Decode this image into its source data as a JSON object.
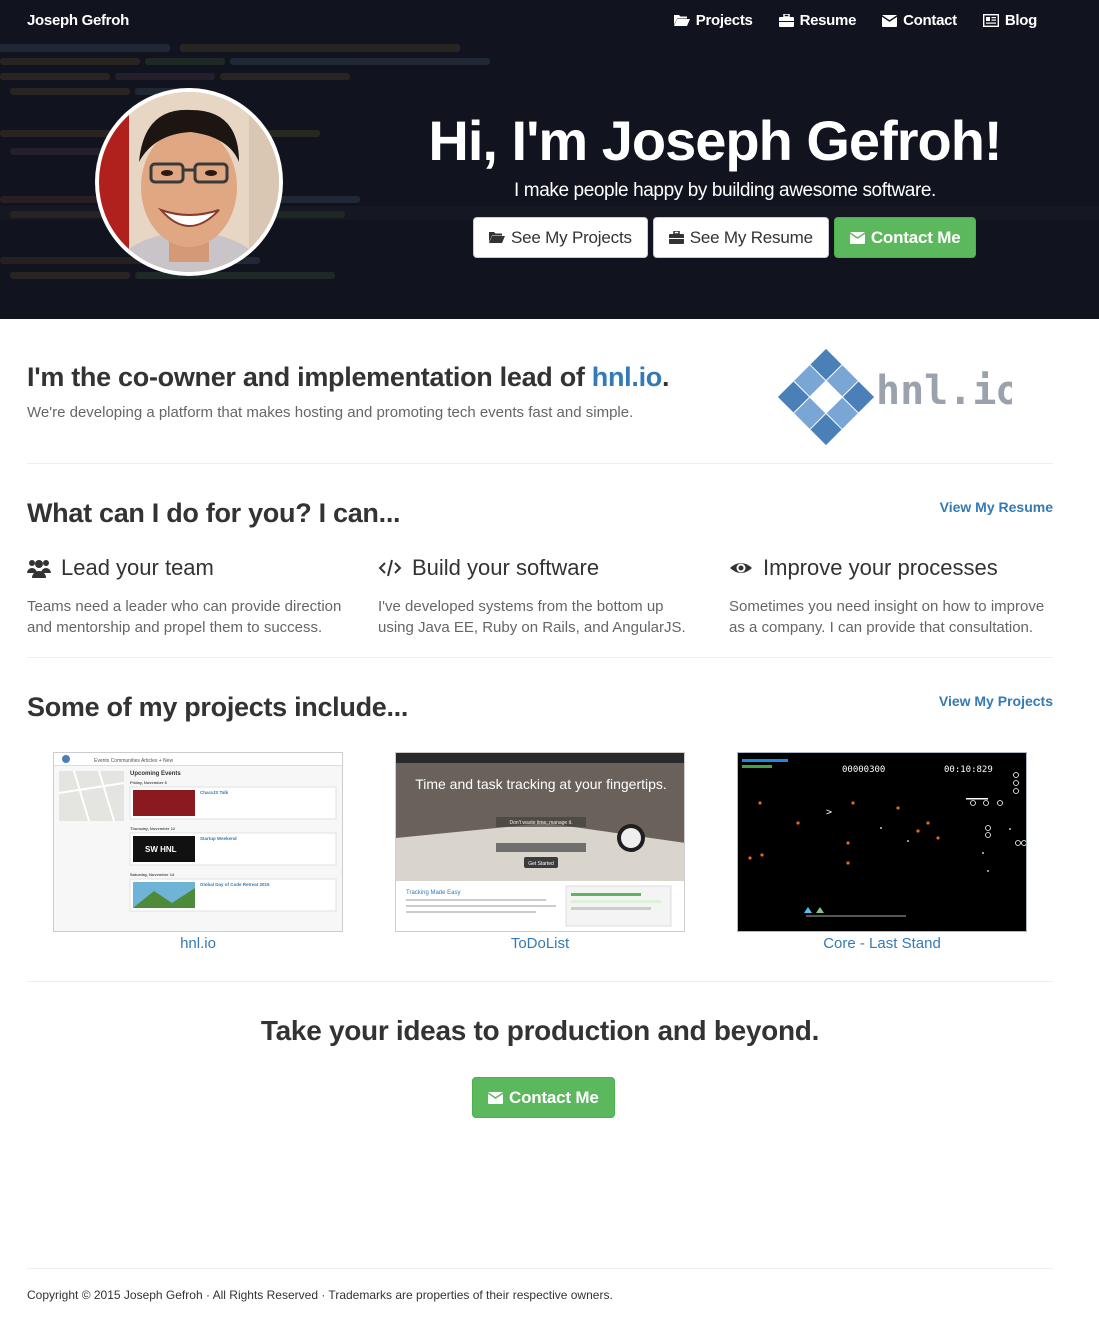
{
  "nav": {
    "brand": "Joseph Gefroh",
    "links": [
      {
        "label": "Projects",
        "icon": "folder-open-icon"
      },
      {
        "label": "Resume",
        "icon": "briefcase-icon"
      },
      {
        "label": "Contact",
        "icon": "envelope-icon"
      },
      {
        "label": "Blog",
        "icon": "newspaper-icon"
      }
    ]
  },
  "hero": {
    "title": "Hi, I'm Joseph Gefroh!",
    "subtitle": "I make people happy by building awesome software.",
    "buttons": {
      "projects": "See My Projects",
      "resume": "See My Resume",
      "contact": "Contact Me"
    }
  },
  "intro": {
    "title_prefix": "I'm the co-owner and implementation lead of ",
    "title_link": "hnl.io",
    "title_suffix": ".",
    "text": "We're developing a platform that makes hosting and promoting tech events fast and simple.",
    "logo_text": "hnl.io"
  },
  "skills": {
    "title": "What can I do for you? I can...",
    "link": "View My Resume",
    "items": [
      {
        "heading": "Lead your team",
        "line1": "Teams need a leader who can provide direction",
        "line2": "and mentorship and propel them to success.",
        "icon": "users-icon"
      },
      {
        "heading": "Build your software",
        "line1": "I've developed systems from the bottom up",
        "line2": "using Java EE, Ruby on Rails, and AngularJS.",
        "icon": "code-icon"
      },
      {
        "heading": "Improve your processes",
        "line1": "Sometimes you need insight on how to improve",
        "line2": "as a company. I can provide that consultation.",
        "icon": "eye-icon"
      }
    ]
  },
  "projects": {
    "title": "Some of my projects include...",
    "link": "View My Projects",
    "items": [
      {
        "label": "hnl.io",
        "shot": {
          "nav_items": "Events   Communities   Articles   + New",
          "heading": "Upcoming Events",
          "day1": "Friday, November 6",
          "event1": "CharaJS Talk",
          "day2": "Thursday, November 12",
          "event2": "Startup Weekend",
          "event2_logo": "SW HNL",
          "day3": "Saturday, November 14",
          "event3": "Global Day of Code Retreat 2015"
        }
      },
      {
        "label": "ToDoList",
        "shot": {
          "headline": "Time and task tracking at your fingertips.",
          "tagline": "Don't waste time; manage it.",
          "button": "Get Started",
          "feature": "Tracking Made Easy"
        }
      },
      {
        "label": "Core - Last Stand",
        "shot": {
          "score": "00000300",
          "timer": "00:10:829"
        }
      }
    ]
  },
  "cta": {
    "title": "Take your ideas to production and beyond.",
    "button": "Contact Me"
  },
  "footer": {
    "text": "Copyright © 2015 Joseph Gefroh · All Rights Reserved · Trademarks are properties of their respective owners."
  },
  "colors": {
    "hero_bg": "#11131e",
    "link": "#337ab7",
    "success": "#5cb85c",
    "hnl_blue": "#4a7fb8"
  }
}
